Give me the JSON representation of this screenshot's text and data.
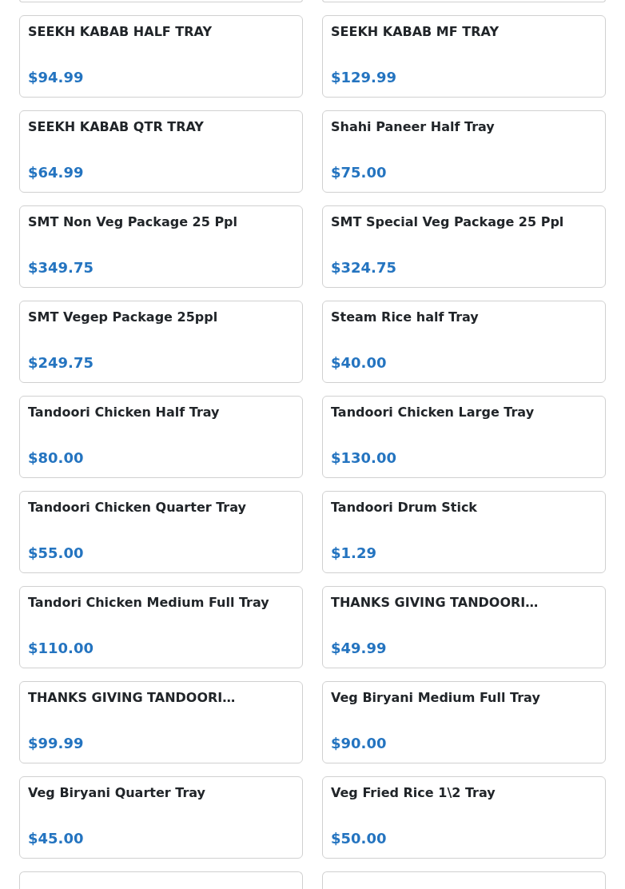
{
  "products": [
    {
      "name": "SEEKH KABAB HALF TRAY",
      "price": "$94.99"
    },
    {
      "name": "SEEKH KABAB MF TRAY",
      "price": "$129.99"
    },
    {
      "name": "SEEKH KABAB QTR TRAY",
      "price": "$64.99"
    },
    {
      "name": "Shahi Paneer Half Tray",
      "price": "$75.00"
    },
    {
      "name": "SMT Non Veg Package 25 Ppl",
      "price": "$349.75"
    },
    {
      "name": "SMT Special Veg Package 25 Ppl",
      "price": "$324.75"
    },
    {
      "name": "SMT Vegep Package 25ppl",
      "price": "$249.75"
    },
    {
      "name": "Steam Rice half Tray",
      "price": "$40.00"
    },
    {
      "name": "Tandoori Chicken Half Tray",
      "price": "$80.00"
    },
    {
      "name": "Tandoori Chicken Large Tray",
      "price": "$130.00"
    },
    {
      "name": "Tandoori Chicken Quarter Tray",
      "price": "$55.00"
    },
    {
      "name": "Tandoori Drum Stick",
      "price": "$1.29"
    },
    {
      "name": "Tandori Chicken Medium Full Tray",
      "price": "$110.00"
    },
    {
      "name": "THANKS GIVING TANDOORI…",
      "price": "$49.99"
    },
    {
      "name": "THANKS GIVING TANDOORI…",
      "price": "$99.99"
    },
    {
      "name": "Veg Biryani Medium Full Tray",
      "price": "$90.00"
    },
    {
      "name": "Veg Biryani Quarter Tray",
      "price": "$45.00"
    },
    {
      "name": "Veg Fried Rice 1\\2 Tray",
      "price": "$50.00"
    }
  ]
}
